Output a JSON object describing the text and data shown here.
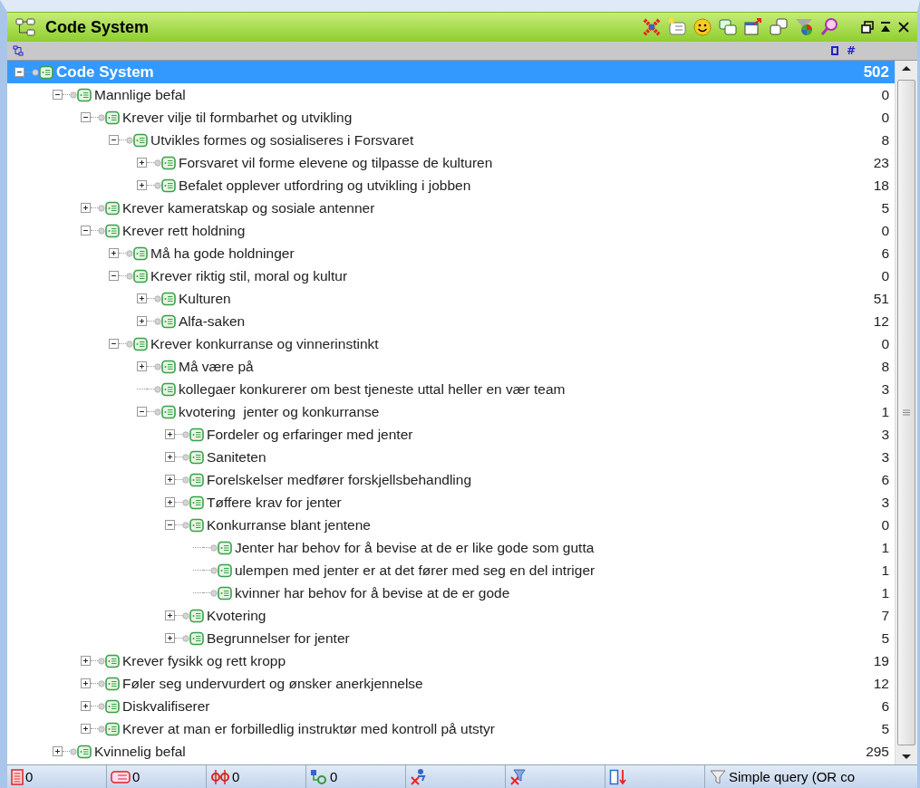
{
  "panel": {
    "title": "Code System"
  },
  "header": {
    "count_column": "#"
  },
  "tree": [
    {
      "label": "Code System",
      "count": "502",
      "selected": true,
      "expanded": true,
      "children": [
        {
          "label": "Mannlige befal",
          "count": "0",
          "selected": false,
          "expanded": true,
          "children": [
            {
              "label": "Krever vilje til formbarhet og utvikling",
              "count": "0",
              "selected": false,
              "expanded": true,
              "children": [
                {
                  "label": "Utvikles formes og sosialiseres i Forsvaret",
                  "count": "8",
                  "selected": false,
                  "expanded": true,
                  "children": [
                    {
                      "label": "Forsvaret vil forme elevene og tilpasse de kulturen",
                      "count": "23",
                      "selected": false,
                      "expanded": false
                    },
                    {
                      "label": "Befalet opplever utfordring og utvikling i jobben",
                      "count": "18",
                      "selected": false,
                      "expanded": false
                    }
                  ]
                }
              ]
            },
            {
              "label": "Krever kameratskap og sosiale antenner",
              "count": "5",
              "selected": false,
              "expanded": false
            },
            {
              "label": "Krever rett holdning",
              "count": "0",
              "selected": false,
              "expanded": true,
              "children": [
                {
                  "label": "Må ha gode holdninger",
                  "count": "6",
                  "selected": false,
                  "expanded": false
                },
                {
                  "label": "Krever riktig stil, moral og kultur",
                  "count": "0",
                  "selected": false,
                  "expanded": true,
                  "children": [
                    {
                      "label": "Kulturen",
                      "count": "51",
                      "selected": false,
                      "expanded": false
                    },
                    {
                      "label": "Alfa-saken",
                      "count": "12",
                      "selected": false,
                      "expanded": false
                    }
                  ]
                },
                {
                  "label": "Krever konkurranse og vinnerinstinkt",
                  "count": "0",
                  "selected": false,
                  "expanded": true,
                  "children": [
                    {
                      "label": "Må være på",
                      "count": "8",
                      "selected": false,
                      "expanded": false
                    },
                    {
                      "label": "kollegaer konkurerer om best tjeneste uttal heller en vær team",
                      "count": "3",
                      "selected": false
                    },
                    {
                      "label": "kvotering  jenter og konkurranse",
                      "count": "1",
                      "selected": false,
                      "expanded": true,
                      "children": [
                        {
                          "label": "Fordeler og erfaringer med jenter",
                          "count": "3",
                          "selected": false,
                          "expanded": false
                        },
                        {
                          "label": "Saniteten",
                          "count": "3",
                          "selected": false,
                          "expanded": false
                        },
                        {
                          "label": "Forelskelser medfører forskjellsbehandling",
                          "count": "6",
                          "selected": false,
                          "expanded": false
                        },
                        {
                          "label": "Tøffere krav for jenter",
                          "count": "3",
                          "selected": false,
                          "expanded": false
                        },
                        {
                          "label": "Konkurranse blant jentene",
                          "count": "0",
                          "selected": false,
                          "expanded": true,
                          "children": [
                            {
                              "label": "Jenter har behov for å bevise at de er like gode som gutta",
                              "count": "1",
                              "selected": false
                            },
                            {
                              "label": "ulempen med jenter er at det fører med seg en del intriger",
                              "count": "1",
                              "selected": false
                            },
                            {
                              "label": "kvinner har behov for å bevise at de er gode",
                              "count": "1",
                              "selected": false
                            }
                          ]
                        },
                        {
                          "label": "Kvotering",
                          "count": "7",
                          "selected": false,
                          "expanded": false
                        },
                        {
                          "label": "Begrunnelser for jenter",
                          "count": "5",
                          "selected": false,
                          "expanded": false
                        }
                      ]
                    }
                  ]
                }
              ]
            },
            {
              "label": "Krever fysikk og rett kropp",
              "count": "19",
              "selected": false,
              "expanded": false
            },
            {
              "label": "Føler seg undervurdert og ønsker anerkjennelse",
              "count": "12",
              "selected": false,
              "expanded": false
            },
            {
              "label": "Diskvalifiserer",
              "count": "6",
              "selected": false,
              "expanded": false
            },
            {
              "label": "Krever at man er forbilledlig instruktør med kontroll på utstyr",
              "count": "5",
              "selected": false,
              "expanded": false
            }
          ]
        },
        {
          "label": "Kvinnelig befal",
          "count": "295",
          "selected": false,
          "expanded": false
        }
      ]
    }
  ],
  "status_bar": [
    {
      "kind": "documents",
      "value": "0"
    },
    {
      "kind": "codes",
      "value": "0"
    },
    {
      "kind": "segments",
      "value": "0"
    },
    {
      "kind": "variables",
      "value": "0"
    },
    {
      "kind": "cross"
    },
    {
      "kind": "filter-cross"
    },
    {
      "kind": "sort"
    },
    {
      "kind": "query",
      "value": "Simple query (OR co"
    }
  ]
}
